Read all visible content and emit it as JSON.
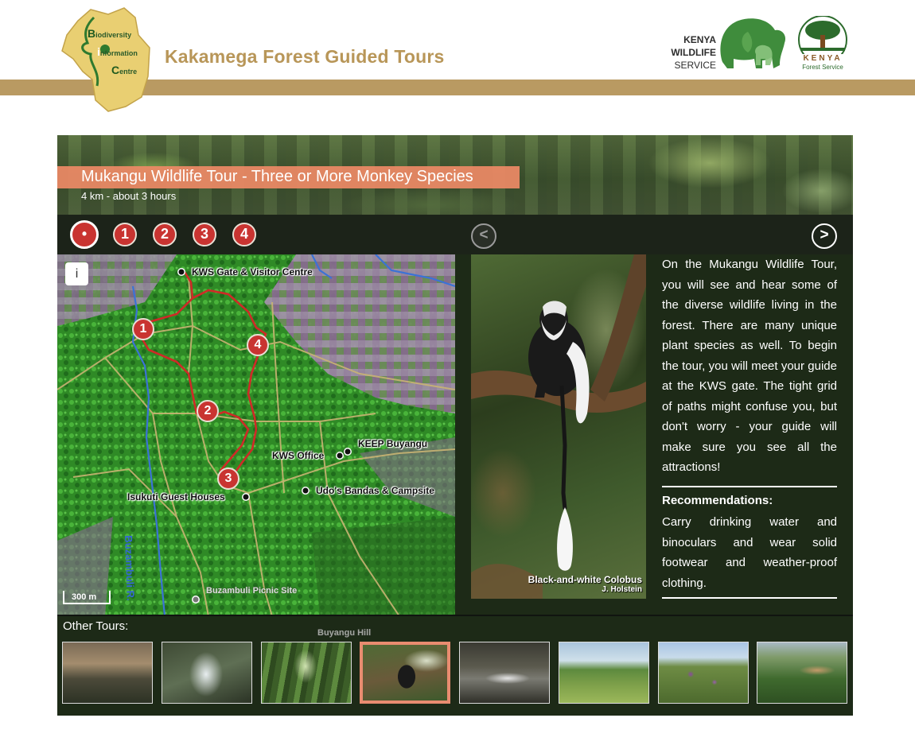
{
  "header": {
    "bic_logo": {
      "letter_b": "B",
      "text_b": "iodiversity",
      "letter_i": "i",
      "text_i": "nformation",
      "letter_c": "C",
      "text_c": "entre"
    },
    "site_title": "Kakamega Forest Guided Tours",
    "kws_logo": {
      "line1": "KENYA",
      "line2": "WILDLIFE",
      "line3": "SERVICE"
    },
    "kfs_logo": {
      "name": "KENYA",
      "sub": "Forest Service"
    }
  },
  "tour": {
    "title": "Mukangu Wildlife Tour - Three or More Monkey Species",
    "subtitle": "4 km - about 3 hours",
    "stops": [
      {
        "label": "•",
        "active": true
      },
      {
        "label": "1"
      },
      {
        "label": "2"
      },
      {
        "label": "3"
      },
      {
        "label": "4"
      }
    ],
    "nav": {
      "prev": "<",
      "next": ">"
    }
  },
  "map": {
    "info_button": "i",
    "scale": "300 m",
    "river": "Buzambuli R.",
    "labels": {
      "kws_gate": "KWS Gate & Visitor Centre",
      "keep": "KEEP Buyangu",
      "kws_office": "KWS Office",
      "udos": "Udo's Bandas & Campsite",
      "isukuti": "Isukuti Guest Houses",
      "buzambuli": "Buzambuli Picnic Site",
      "buyangu_hill": "Buyangu Hill"
    },
    "markers": [
      "1",
      "2",
      "3",
      "4"
    ]
  },
  "photo": {
    "caption": "Black-and-white Colobus",
    "credit": "J. Holstein"
  },
  "description": "On the Mukangu Wildlife Tour, you will see and hear some of the diverse wildlife living in the forest. There are many unique plant species as well. To begin the tour, you will meet your guide at the KWS gate. The tight grid of paths might confuse you, but don't worry - your guide will make sure you see all the attractions!",
  "recommendations": {
    "heading": "Recommendations:",
    "text": "Carry drinking water and binoculars and wear solid footwear and weather-proof clothing."
  },
  "other_tours": {
    "label": "Other Tours:",
    "thumbs": [
      "misty-forest-view",
      "waterfall",
      "forest-path-walker",
      "colobus-monkey",
      "river-rapids",
      "grassland-hill-view",
      "flowers-grassland",
      "aerial-forest-clearing"
    ],
    "active_index": 3
  }
}
